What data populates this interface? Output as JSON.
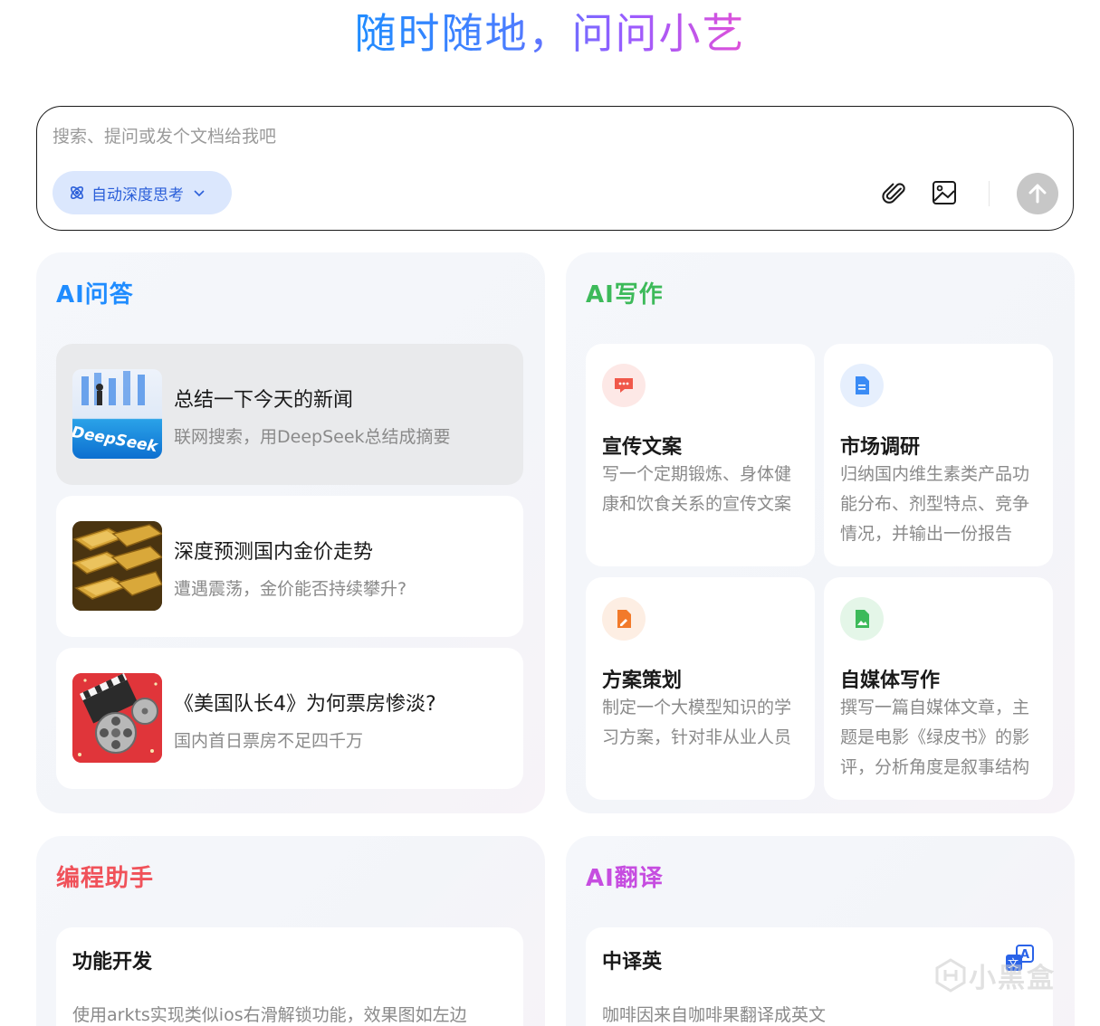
{
  "hero": {
    "title": "随时随地，问问小艺"
  },
  "search": {
    "placeholder": "搜索、提问或发个文档给我吧",
    "mode_label": "自动深度思考",
    "icons": [
      "attachment-icon",
      "image-icon",
      "send-arrow-icon"
    ]
  },
  "qa": {
    "title": "AI问答",
    "title_color": "#1f8cff",
    "items": [
      {
        "title": "总结一下今天的新闻",
        "subtitle": "联网搜索，用DeepSeek总结成摘要",
        "thumb_text": "DeepSeek"
      },
      {
        "title": "深度预测国内金价走势",
        "subtitle": "遭遇震荡，金价能否持续攀升?"
      },
      {
        "title": "《美国队长4》为何票房惨淡?",
        "subtitle": "国内首日票房不足四千万"
      }
    ]
  },
  "writing": {
    "title": "AI写作",
    "title_color": "#3dba5a",
    "items": [
      {
        "title": "宣传文案",
        "desc": "写一个定期锻炼、身体健康和饮食关系的宣传文案",
        "icon": "chat-bubble-icon",
        "color": "#f0584a"
      },
      {
        "title": "市场调研",
        "desc": "归纳国内维生素类产品功能分布、剂型特点、竞争情况，并输出一份报告",
        "icon": "document-icon",
        "color": "#3a8bf5"
      },
      {
        "title": "方案策划",
        "desc": "制定一个大模型知识的学习方案，针对非从业人员",
        "icon": "edit-doc-icon",
        "color": "#f27a2a"
      },
      {
        "title": "自媒体写作",
        "desc": "撰写一篇自媒体文章，主题是电影《绿皮书》的影评，分析角度是叙事结构",
        "icon": "image-doc-icon",
        "color": "#3dba5a"
      }
    ]
  },
  "coding": {
    "title": "编程助手",
    "title_color": "#f0525a",
    "item": {
      "title": "功能开发",
      "desc": "使用arkts实现类似ios右滑解锁功能，效果图如左边"
    }
  },
  "translate": {
    "title": "AI翻译",
    "title_color": "#c64de0",
    "item": {
      "title": "中译英",
      "desc": "咖啡因来自咖啡果翻译成英文",
      "icon": "translate-icon"
    }
  },
  "watermark": {
    "text": "小黑盒"
  }
}
